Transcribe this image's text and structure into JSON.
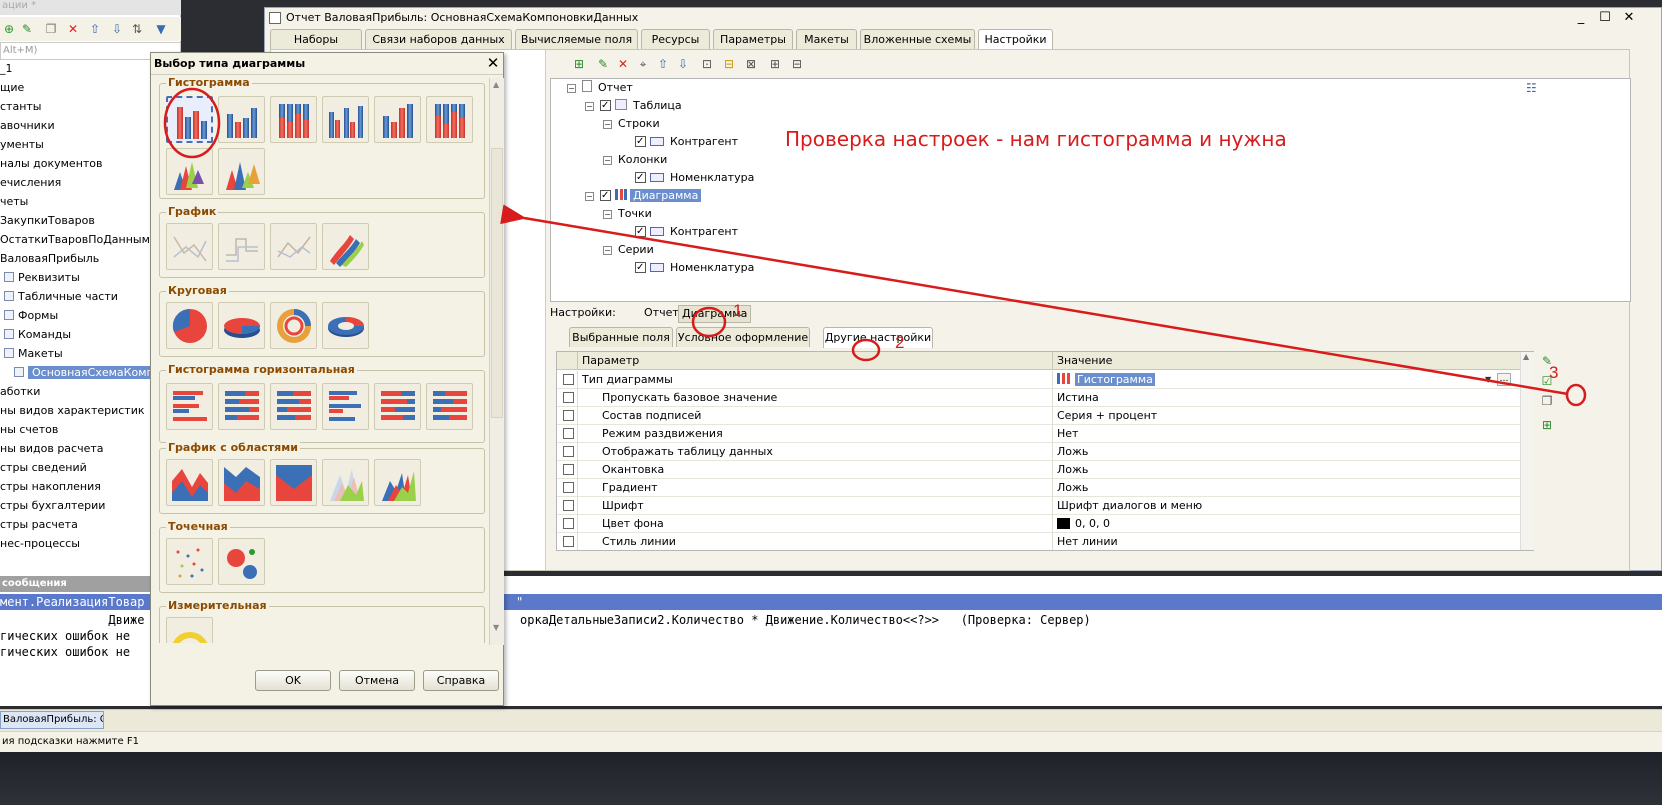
{
  "left_panel": {
    "title": "ации *",
    "search_placeholder": "Alt+M)",
    "items": [
      {
        "label": "_1",
        "indent": 0
      },
      {
        "label": "щие",
        "indent": 0
      },
      {
        "label": "станты",
        "indent": 0
      },
      {
        "label": "авочники",
        "indent": 0
      },
      {
        "label": "ументы",
        "indent": 0
      },
      {
        "label": "налы документов",
        "indent": 0
      },
      {
        "label": "ечисления",
        "indent": 0
      },
      {
        "label": "четы",
        "indent": 0
      },
      {
        "label": "ЗакупкиТоваров",
        "indent": 0
      },
      {
        "label": "ОстаткиТваровПоДаннымДоку",
        "indent": 0
      },
      {
        "label": "ВаловаяПрибыль",
        "indent": 0
      },
      {
        "label": "Реквизиты",
        "indent": 1
      },
      {
        "label": "Табличные части",
        "indent": 1
      },
      {
        "label": "Формы",
        "indent": 1
      },
      {
        "label": "Команды",
        "indent": 1
      },
      {
        "label": "Макеты",
        "indent": 1
      },
      {
        "label": "ОсновнаяСхемаКомпон",
        "indent": 2,
        "selected": true
      },
      {
        "label": "аботки",
        "indent": 0
      },
      {
        "label": "ны видов характеристик",
        "indent": 0
      },
      {
        "label": "ны счетов",
        "indent": 0
      },
      {
        "label": "ны видов расчета",
        "indent": 0
      },
      {
        "label": "стры сведений",
        "indent": 0
      },
      {
        "label": "стры накопления",
        "indent": 0
      },
      {
        "label": "стры бухгалтерии",
        "indent": 0
      },
      {
        "label": "стры расчета",
        "indent": 0
      },
      {
        "label": "нес-процессы",
        "indent": 0
      }
    ]
  },
  "messages": {
    "title": "сообщения",
    "highlight_line": "мент.РеализацияТовар",
    "highlight_tail": "\"",
    "lines": [
      "               Движе",
      "гических ошибок не",
      "гических ошибок не"
    ],
    "detail": "оркаДетальныеЗаписи2.Количество * Движение.Количество<<?>>   (Проверка: Сервер)"
  },
  "taskbar": {
    "button": "ВаловаяПрибыль: О..."
  },
  "status": {
    "hint": "ия подсказки нажмите F1"
  },
  "main_window": {
    "title": "Отчет ВаловаяПрибыль: ОсновнаяСхемаКомпоновкиДанных",
    "tabs": [
      "Наборы данных",
      "Связи наборов данных",
      "Вычисляемые поля",
      "Ресурсы",
      "Параметры",
      "Макеты",
      "Вложенные схемы",
      "Настройки"
    ],
    "active_tab": "Настройки"
  },
  "structure": {
    "root": "Отчет",
    "table": "Таблица",
    "rows_label": "Строки",
    "rows_field": "Контрагент",
    "cols_label": "Колонки",
    "cols_field": "Номенклатура",
    "diagram": "Диаграмма",
    "points_label": "Точки",
    "points_field": "Контрагент",
    "series_label": "Серии",
    "series_field": "Номенклатура"
  },
  "annotation": "Проверка настроек - нам гистограмма и нужна",
  "markers": [
    "1",
    "2",
    "3"
  ],
  "settings": {
    "label": "Настройки:",
    "items": [
      "Отчет",
      "Диаграмма"
    ],
    "subtabs": [
      "Выбранные поля",
      "Условное оформление",
      "Другие настройки"
    ],
    "active_subtab": "Другие настройки"
  },
  "grid": {
    "header_param": "Параметр",
    "header_value": "Значение",
    "rows": [
      {
        "param": "Тип диаграммы",
        "value": "Гистограмма",
        "level": 0,
        "selected": true
      },
      {
        "param": "Пропускать базовое значение",
        "value": "Истина",
        "level": 1
      },
      {
        "param": "Состав подписей",
        "value": "Серия + процент",
        "level": 1
      },
      {
        "param": "Режим раздвижения",
        "value": "Нет",
        "level": 1
      },
      {
        "param": "Отображать таблицу данных",
        "value": "Ложь",
        "level": 1
      },
      {
        "param": "Окантовка",
        "value": "Ложь",
        "level": 1
      },
      {
        "param": "Градиент",
        "value": "Ложь",
        "level": 1
      },
      {
        "param": "Шрифт",
        "value": "Шрифт диалогов и меню",
        "level": 1
      },
      {
        "param": "Цвет фона",
        "value": "0, 0, 0",
        "level": 1,
        "swatch": "#000000"
      },
      {
        "param": "Стиль линии",
        "value": "Нет линии",
        "level": 1
      }
    ]
  },
  "dialog": {
    "title": "Выбор типа диаграммы",
    "groups": [
      {
        "title": "Гистограмма",
        "count": 8
      },
      {
        "title": "График",
        "count": 4
      },
      {
        "title": "Круговая",
        "count": 4
      },
      {
        "title": "Гистограмма горизонтальная",
        "count": 6
      },
      {
        "title": "График с областями",
        "count": 5
      },
      {
        "title": "Точечная",
        "count": 2
      },
      {
        "title": "Измерительная",
        "count": 1
      }
    ],
    "buttons": {
      "ok": "OK",
      "cancel": "Отмена",
      "help": "Справка"
    }
  },
  "colors": {
    "red": "#e8453c",
    "blue": "#3b6fb6",
    "annotation": "#d81b1b",
    "selection": "#6b8fce"
  }
}
